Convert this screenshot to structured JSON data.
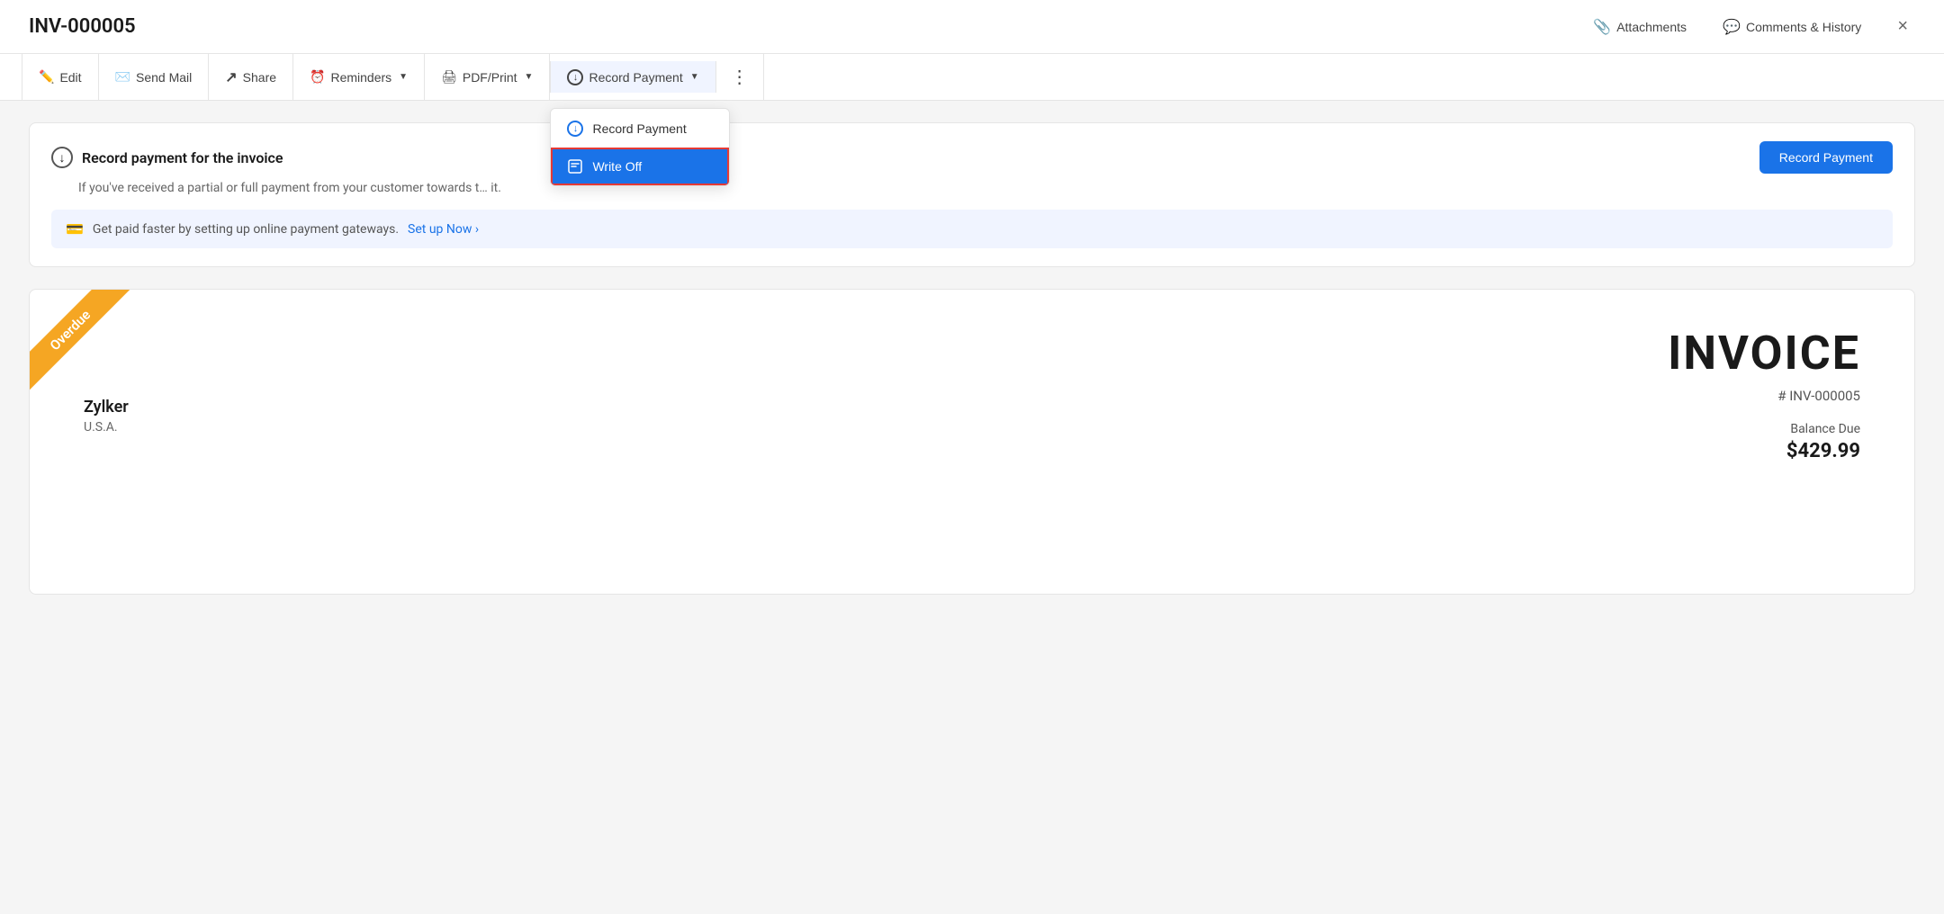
{
  "header": {
    "title": "INV-000005",
    "attachments_label": "Attachments",
    "comments_label": "Comments & History",
    "close_label": "×"
  },
  "toolbar": {
    "edit_label": "Edit",
    "send_mail_label": "Send Mail",
    "share_label": "Share",
    "reminders_label": "Reminders",
    "pdf_print_label": "PDF/Print",
    "record_payment_label": "Record Payment",
    "more_label": "⋮"
  },
  "dropdown": {
    "record_payment_item": "Record Payment",
    "write_off_item": "Write Off"
  },
  "payment_banner": {
    "title": "Record payment for the invoice",
    "description": "If you've received a partial or full payment from your customer towards t… it.",
    "record_btn_label": "Record Payment",
    "gateway_text": "Get paid faster by setting up online payment gateways.",
    "setup_link": "Set up Now ›"
  },
  "invoice": {
    "overdue_label": "Overdue",
    "customer_name": "Zylker",
    "customer_country": "U.S.A.",
    "heading": "INVOICE",
    "number_prefix": "#",
    "number": "INV-000005",
    "balance_due_label": "Balance Due",
    "balance_due_value": "$429.99"
  }
}
